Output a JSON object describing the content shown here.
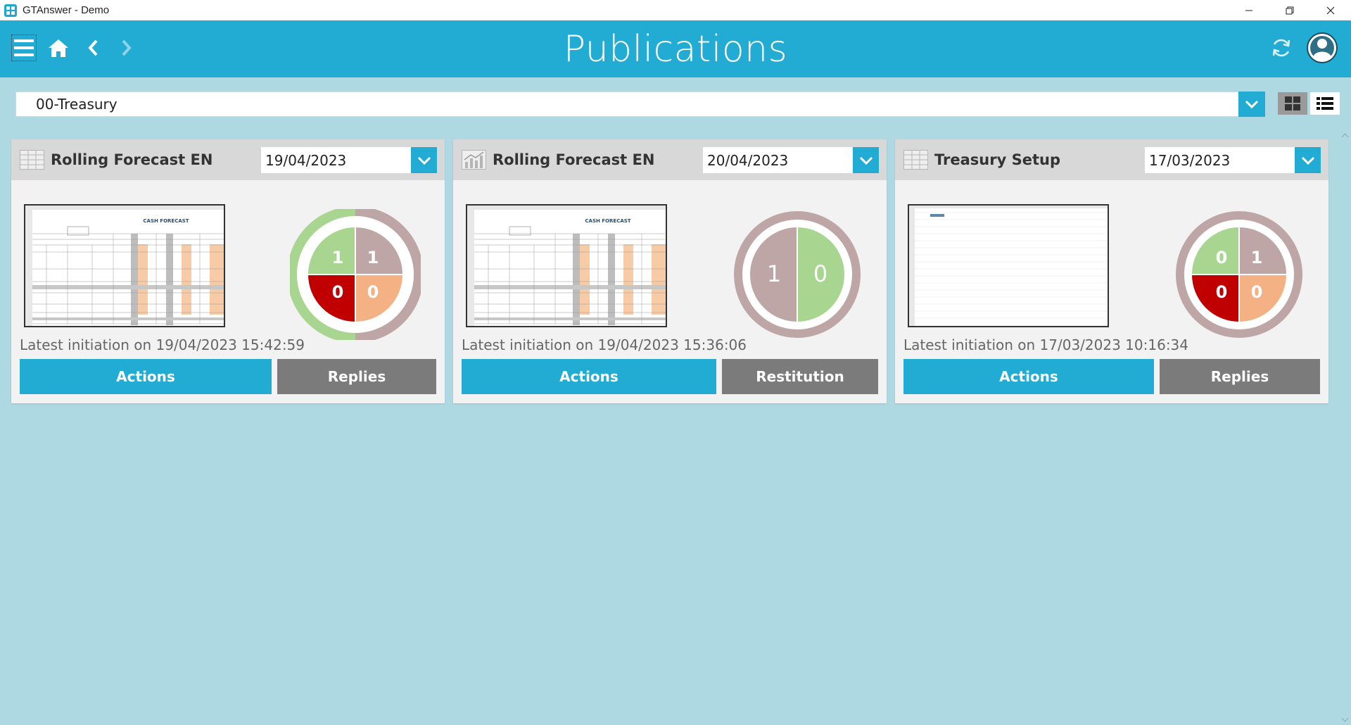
{
  "window": {
    "title": "GTAnswer - Demo",
    "controls": {
      "minimize": "—",
      "restore": "❐",
      "close": "✕"
    }
  },
  "header": {
    "title": "Publications",
    "icons": [
      "menu-icon",
      "home-icon",
      "back-icon",
      "forward-icon",
      "refresh-icon",
      "user-avatar-icon"
    ]
  },
  "filter": {
    "value": "00-Treasury",
    "view_modes": [
      "grid-view-icon",
      "list-view-icon"
    ]
  },
  "colors": {
    "accent": "#22acd4",
    "green": "#a8d58f",
    "red": "#c00000",
    "orange": "#f4b183",
    "taupe": "#bfa6a6",
    "secondary_button": "#7b7b7b"
  },
  "cards": [
    {
      "title": "Rolling Forecast EN",
      "icon": "table-icon",
      "date": "19/04/2023",
      "initiation": "Latest initiation on 19/04/2023 15:42:59",
      "thumbnail_title": "CASH FORECAST",
      "primary_label": "Actions",
      "secondary_label": "Replies",
      "donut": {
        "type": "quad",
        "values": [
          "1",
          "1",
          "0",
          "0"
        ]
      }
    },
    {
      "title": "Rolling Forecast EN",
      "icon": "chart-icon",
      "date": "20/04/2023",
      "initiation": "Latest initiation on 19/04/2023 15:36:06",
      "thumbnail_title": "CASH FORECAST",
      "primary_label": "Actions",
      "secondary_label": "Restitution",
      "donut": {
        "type": "half",
        "values": [
          "1",
          "0"
        ]
      }
    },
    {
      "title": "Treasury Setup",
      "icon": "table-icon",
      "date": "17/03/2023",
      "initiation": "Latest initiation on 17/03/2023 10:16:34",
      "thumbnail_title": "",
      "primary_label": "Actions",
      "secondary_label": "Replies",
      "donut": {
        "type": "quad",
        "values": [
          "0",
          "1",
          "0",
          "0"
        ]
      }
    }
  ]
}
